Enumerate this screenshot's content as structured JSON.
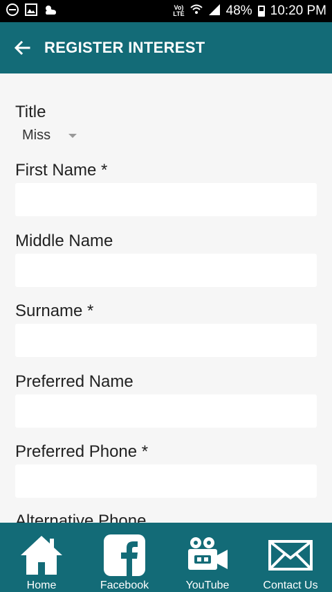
{
  "status_bar": {
    "volte_top": "Vo)",
    "volte_bottom": "LTE",
    "battery_percent": "48%",
    "time": "10:20 PM"
  },
  "app_bar": {
    "title": "REGISTER INTEREST"
  },
  "form": {
    "title_label": "Title",
    "title_value": "Miss",
    "first_name_label": "First Name *",
    "first_name_value": "",
    "middle_name_label": "Middle Name",
    "middle_name_value": "",
    "surname_label": "Surname *",
    "surname_value": "",
    "preferred_name_label": "Preferred Name",
    "preferred_name_value": "",
    "preferred_phone_label": "Preferred Phone *",
    "preferred_phone_value": "",
    "alternative_phone_label": "Alternative Phone"
  },
  "bottom_nav": {
    "home": "Home",
    "facebook": "Facebook",
    "youtube": "YouTube",
    "contact": "Contact Us"
  },
  "colors": {
    "primary": "#136b77",
    "background": "#f6f6f6"
  }
}
